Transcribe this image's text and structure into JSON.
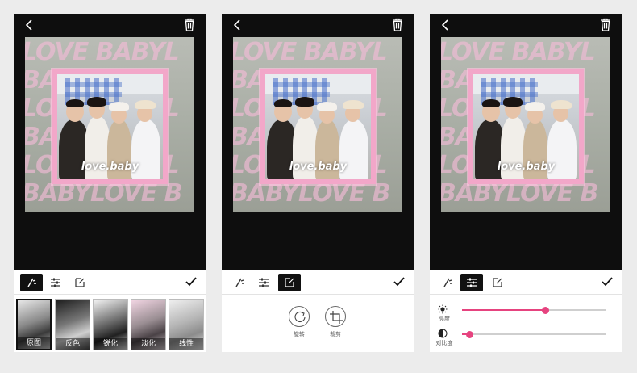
{
  "photo": {
    "bg_text_rows": [
      "LOVE BABYL",
      "BABYLOVE",
      "LOVE BABYL",
      "BABYLOVE",
      "LOVE BABYL",
      "BABYLOVE B"
    ],
    "caption": "love.baby"
  },
  "colors": {
    "accent": "#e6437f",
    "frame": "#f2a7c9",
    "screen_bg": "#0e0e0e",
    "active_tool": "#111111"
  },
  "tools": [
    "filter-tool",
    "adjust-tool",
    "edit-tool"
  ],
  "screen1": {
    "active_tool": "filter-tool",
    "filters": [
      {
        "label": "原图",
        "selected": true
      },
      {
        "label": "反色",
        "selected": false
      },
      {
        "label": "锐化",
        "selected": false
      },
      {
        "label": "淡化",
        "selected": false
      },
      {
        "label": "线性",
        "selected": false
      }
    ]
  },
  "screen2": {
    "active_tool": "edit-tool",
    "actions": [
      {
        "icon": "rotate-icon",
        "label": "旋转"
      },
      {
        "icon": "crop-icon",
        "label": "裁剪"
      }
    ]
  },
  "screen3": {
    "active_tool": "adjust-tool",
    "sliders": [
      {
        "icon": "brightness-icon",
        "label": "亮度",
        "value": 0.58
      },
      {
        "icon": "contrast-icon",
        "label": "对比度",
        "value": 0.05
      }
    ]
  }
}
